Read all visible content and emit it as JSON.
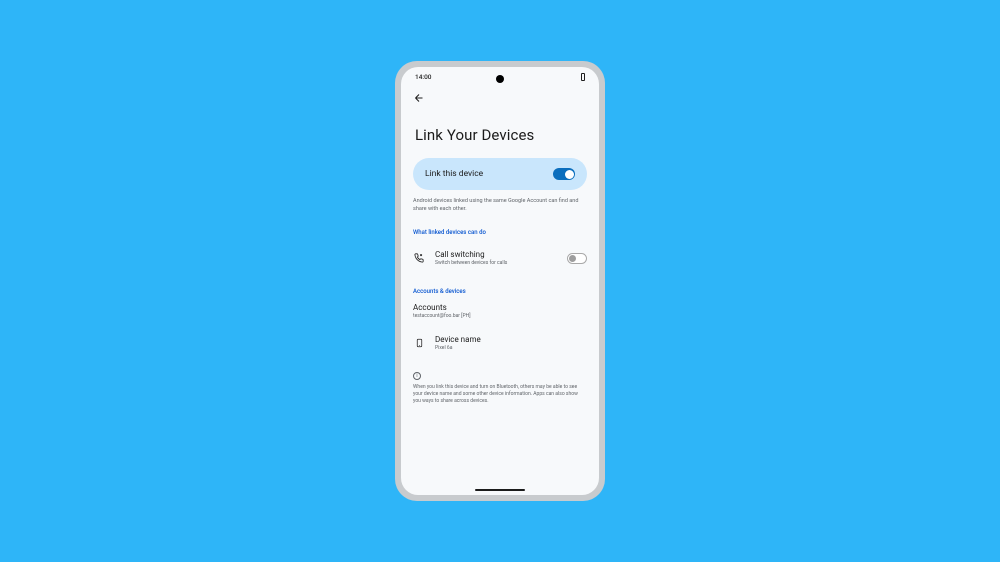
{
  "status": {
    "time": "14:00"
  },
  "page": {
    "title": "Link Your Devices"
  },
  "link_card": {
    "label": "Link this device"
  },
  "description": "Android devices linked using the same Google Account can find and share with each other.",
  "section_features": {
    "header": "What linked devices can do",
    "call_switching": {
      "title": "Call switching",
      "subtitle": "Switch between devices for calls"
    }
  },
  "section_accounts": {
    "header": "Accounts & devices",
    "accounts": {
      "title": "Accounts",
      "subtitle": "testaccount@foo.bar [PH]"
    },
    "device_name": {
      "title": "Device name",
      "subtitle": "Pixel 6a"
    }
  },
  "info": "When you link this device and turn on Bluetooth, others may be able to see your device name and some other device information. Apps can also show you ways to share across devices."
}
